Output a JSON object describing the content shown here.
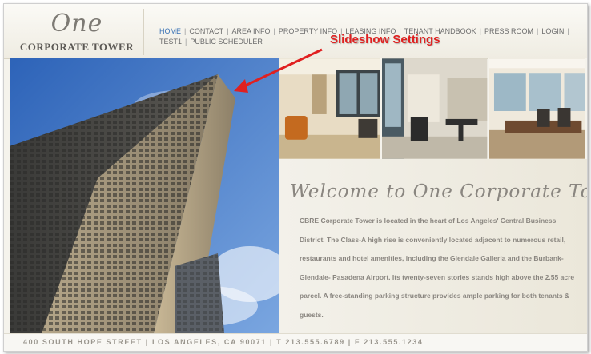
{
  "logo": {
    "script": "One",
    "subtitle": "CORPORATE TOWER"
  },
  "nav": {
    "items": [
      {
        "label": "HOME",
        "active": true
      },
      {
        "label": "CONTACT"
      },
      {
        "label": "AREA INFO"
      },
      {
        "label": "PROPERTY INFO"
      },
      {
        "label": "LEASING INFO"
      },
      {
        "label": "TENANT HANDBOOK"
      },
      {
        "label": "PRESS ROOM"
      },
      {
        "label": "LOGIN"
      },
      {
        "label": "TEST1"
      },
      {
        "label": "PUBLIC SCHEDULER"
      }
    ],
    "separator": "|"
  },
  "callout": {
    "text": "Slideshow Settings",
    "color": "#e02020"
  },
  "welcome": {
    "title": "Welcome to One Corporate Tower",
    "body": "CBRE Corporate Tower is located in the heart of Los Angeles' Central Business District. The Class-A high rise is conveniently located adjacent to numerous retail, restaurants and hotel amenities, including the Glendale Galleria and the Burbank-Glendale- Pasadena Airport. Its twenty-seven stories stands high above the 2.55 acre parcel. A free-standing parking structure provides ample parking for both tenants & guests."
  },
  "footer": {
    "text": "400 SOUTH HOPE STREET | LOS ANGELES, CA 90071 | T 213.555.6789 | F 213.555.1234"
  },
  "colors": {
    "nav_active": "#3a72b5",
    "nav_text": "#6d6d6d",
    "sky": "#4f86d3",
    "background": "#f5f3ec"
  }
}
